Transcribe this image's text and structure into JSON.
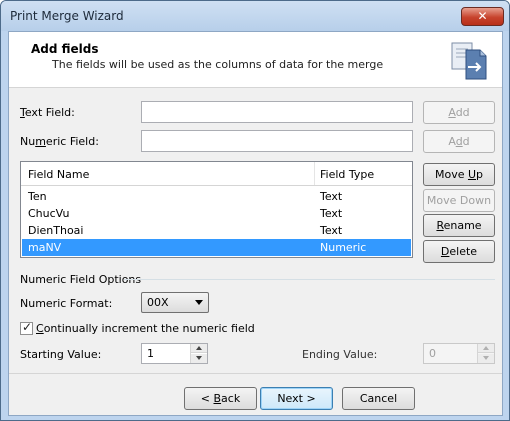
{
  "window": {
    "title": "Print Merge Wizard",
    "close_glyph": "✕"
  },
  "header": {
    "title": "Add fields",
    "subtitle": "The fields will be used as the columns of data for the merge",
    "icon": "merge-document-icon"
  },
  "text_field": {
    "label_prefix": "",
    "label_accel": "T",
    "label_rest": "ext Field:",
    "value": "",
    "add_label_accel": "A",
    "add_label_rest": "dd"
  },
  "numeric_field": {
    "label_prefix": "Nu",
    "label_accel": "m",
    "label_rest": "eric Field:",
    "value": "",
    "add_label_prefix": "A",
    "add_label_accel": "d",
    "add_label_rest": "d"
  },
  "fields_table": {
    "columns": [
      "Field Name",
      "Field Type"
    ],
    "rows": [
      {
        "name": "Ten",
        "type": "Text",
        "selected": false
      },
      {
        "name": "ChucVu",
        "type": "Text",
        "selected": false
      },
      {
        "name": "DienThoai",
        "type": "Text",
        "selected": false
      },
      {
        "name": "maNV",
        "type": "Numeric",
        "selected": true
      }
    ]
  },
  "side_buttons": {
    "move_up_prefix": "Move ",
    "move_up_accel": "U",
    "move_up_rest": "p",
    "move_down": "Move Down",
    "rename_accel": "R",
    "rename_rest": "ename",
    "delete_accel": "D",
    "delete_rest": "elete"
  },
  "numeric_options": {
    "group_label": "Numeric Field Options",
    "format_label": "Numeric Format:",
    "format_value": "00X",
    "increment_checked": true,
    "increment_accel": "C",
    "increment_rest": "ontinually increment the numeric field",
    "starting_label": "Starting Value:",
    "starting_value": "1",
    "ending_label": "Ending Value:",
    "ending_value": "0"
  },
  "footer": {
    "back_prefix": "< ",
    "back_accel": "B",
    "back_rest": "ack",
    "next": "Next >",
    "cancel": "Cancel"
  },
  "colors": {
    "selection": "#3399ff",
    "title_bar": "#bdd4ee",
    "close": "#c7432d"
  }
}
